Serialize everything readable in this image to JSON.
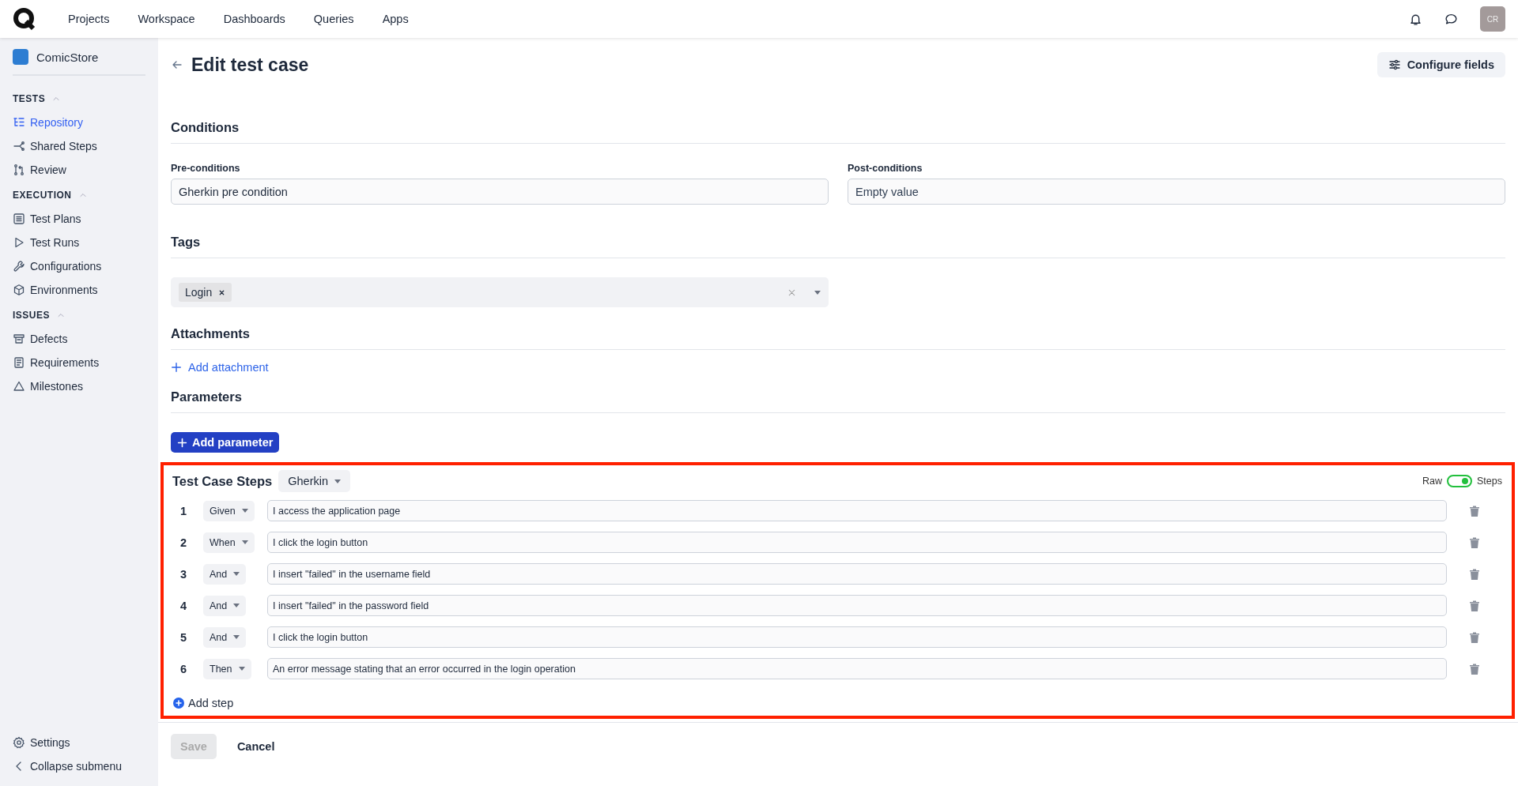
{
  "topbar": {
    "nav": [
      {
        "label": "Projects"
      },
      {
        "label": "Workspace"
      },
      {
        "label": "Dashboards"
      },
      {
        "label": "Queries"
      },
      {
        "label": "Apps"
      }
    ],
    "avatar": "CR"
  },
  "sidebar": {
    "project": "ComicStore",
    "groups": [
      {
        "title": "TESTS",
        "expanded": true,
        "items": [
          {
            "label": "Repository",
            "kind": "tree",
            "selected": true
          },
          {
            "label": "Shared Steps",
            "kind": "share",
            "selected": false
          },
          {
            "label": "Review",
            "kind": "merge",
            "selected": false
          }
        ]
      },
      {
        "title": "EXECUTION",
        "expanded": true,
        "items": [
          {
            "label": "Test Plans",
            "kind": "list",
            "selected": false
          },
          {
            "label": "Test Runs",
            "kind": "play",
            "selected": false
          },
          {
            "label": "Configurations",
            "kind": "wrench",
            "selected": false
          },
          {
            "label": "Environments",
            "kind": "cube",
            "selected": false
          }
        ]
      },
      {
        "title": "ISSUES",
        "expanded": true,
        "items": [
          {
            "label": "Defects",
            "kind": "defect",
            "selected": false
          },
          {
            "label": "Requirements",
            "kind": "book",
            "selected": false
          },
          {
            "label": "Milestones",
            "kind": "triangle",
            "selected": false
          }
        ]
      }
    ],
    "footer": [
      {
        "label": "Settings",
        "kind": "gear"
      },
      {
        "label": "Collapse submenu",
        "kind": "chevron"
      }
    ]
  },
  "page": {
    "title": "Edit test case",
    "configure_button": "Configure fields"
  },
  "conditions": {
    "heading": "Conditions",
    "fields": [
      {
        "label": "Pre-conditions",
        "value": "Gherkin pre condition"
      },
      {
        "label": "Post-conditions",
        "placeholder": "Empty value"
      }
    ]
  },
  "tags": {
    "heading": "Tags",
    "items": [
      {
        "label": "Login"
      }
    ]
  },
  "attachments": {
    "heading": "Attachments",
    "add_link": "Add attachment"
  },
  "parameters": {
    "heading": "Parameters",
    "add_button": "Add parameter"
  },
  "steps": {
    "heading": "Test Case Steps",
    "format": "Gherkin",
    "toggle": {
      "left_label": "Raw",
      "right_label": "Steps",
      "on": true
    },
    "rows": [
      {
        "number": "1",
        "keyword": "Given",
        "text": "I access the application page"
      },
      {
        "number": "2",
        "keyword": "When",
        "text": "I click the login button"
      },
      {
        "number": "3",
        "keyword": "And",
        "text": "I insert \"failed\" in the username field"
      },
      {
        "number": "4",
        "keyword": "And",
        "text": "I insert \"failed\" in the password field"
      },
      {
        "number": "5",
        "keyword": "And",
        "text": "I click the login button"
      },
      {
        "number": "6",
        "keyword": "Then",
        "text": "An error message stating that an error occurred in the login operation"
      }
    ],
    "add_step": "Add step"
  },
  "footer": {
    "save": {
      "label": "Save",
      "disabled": true
    },
    "cancel": "Cancel"
  }
}
